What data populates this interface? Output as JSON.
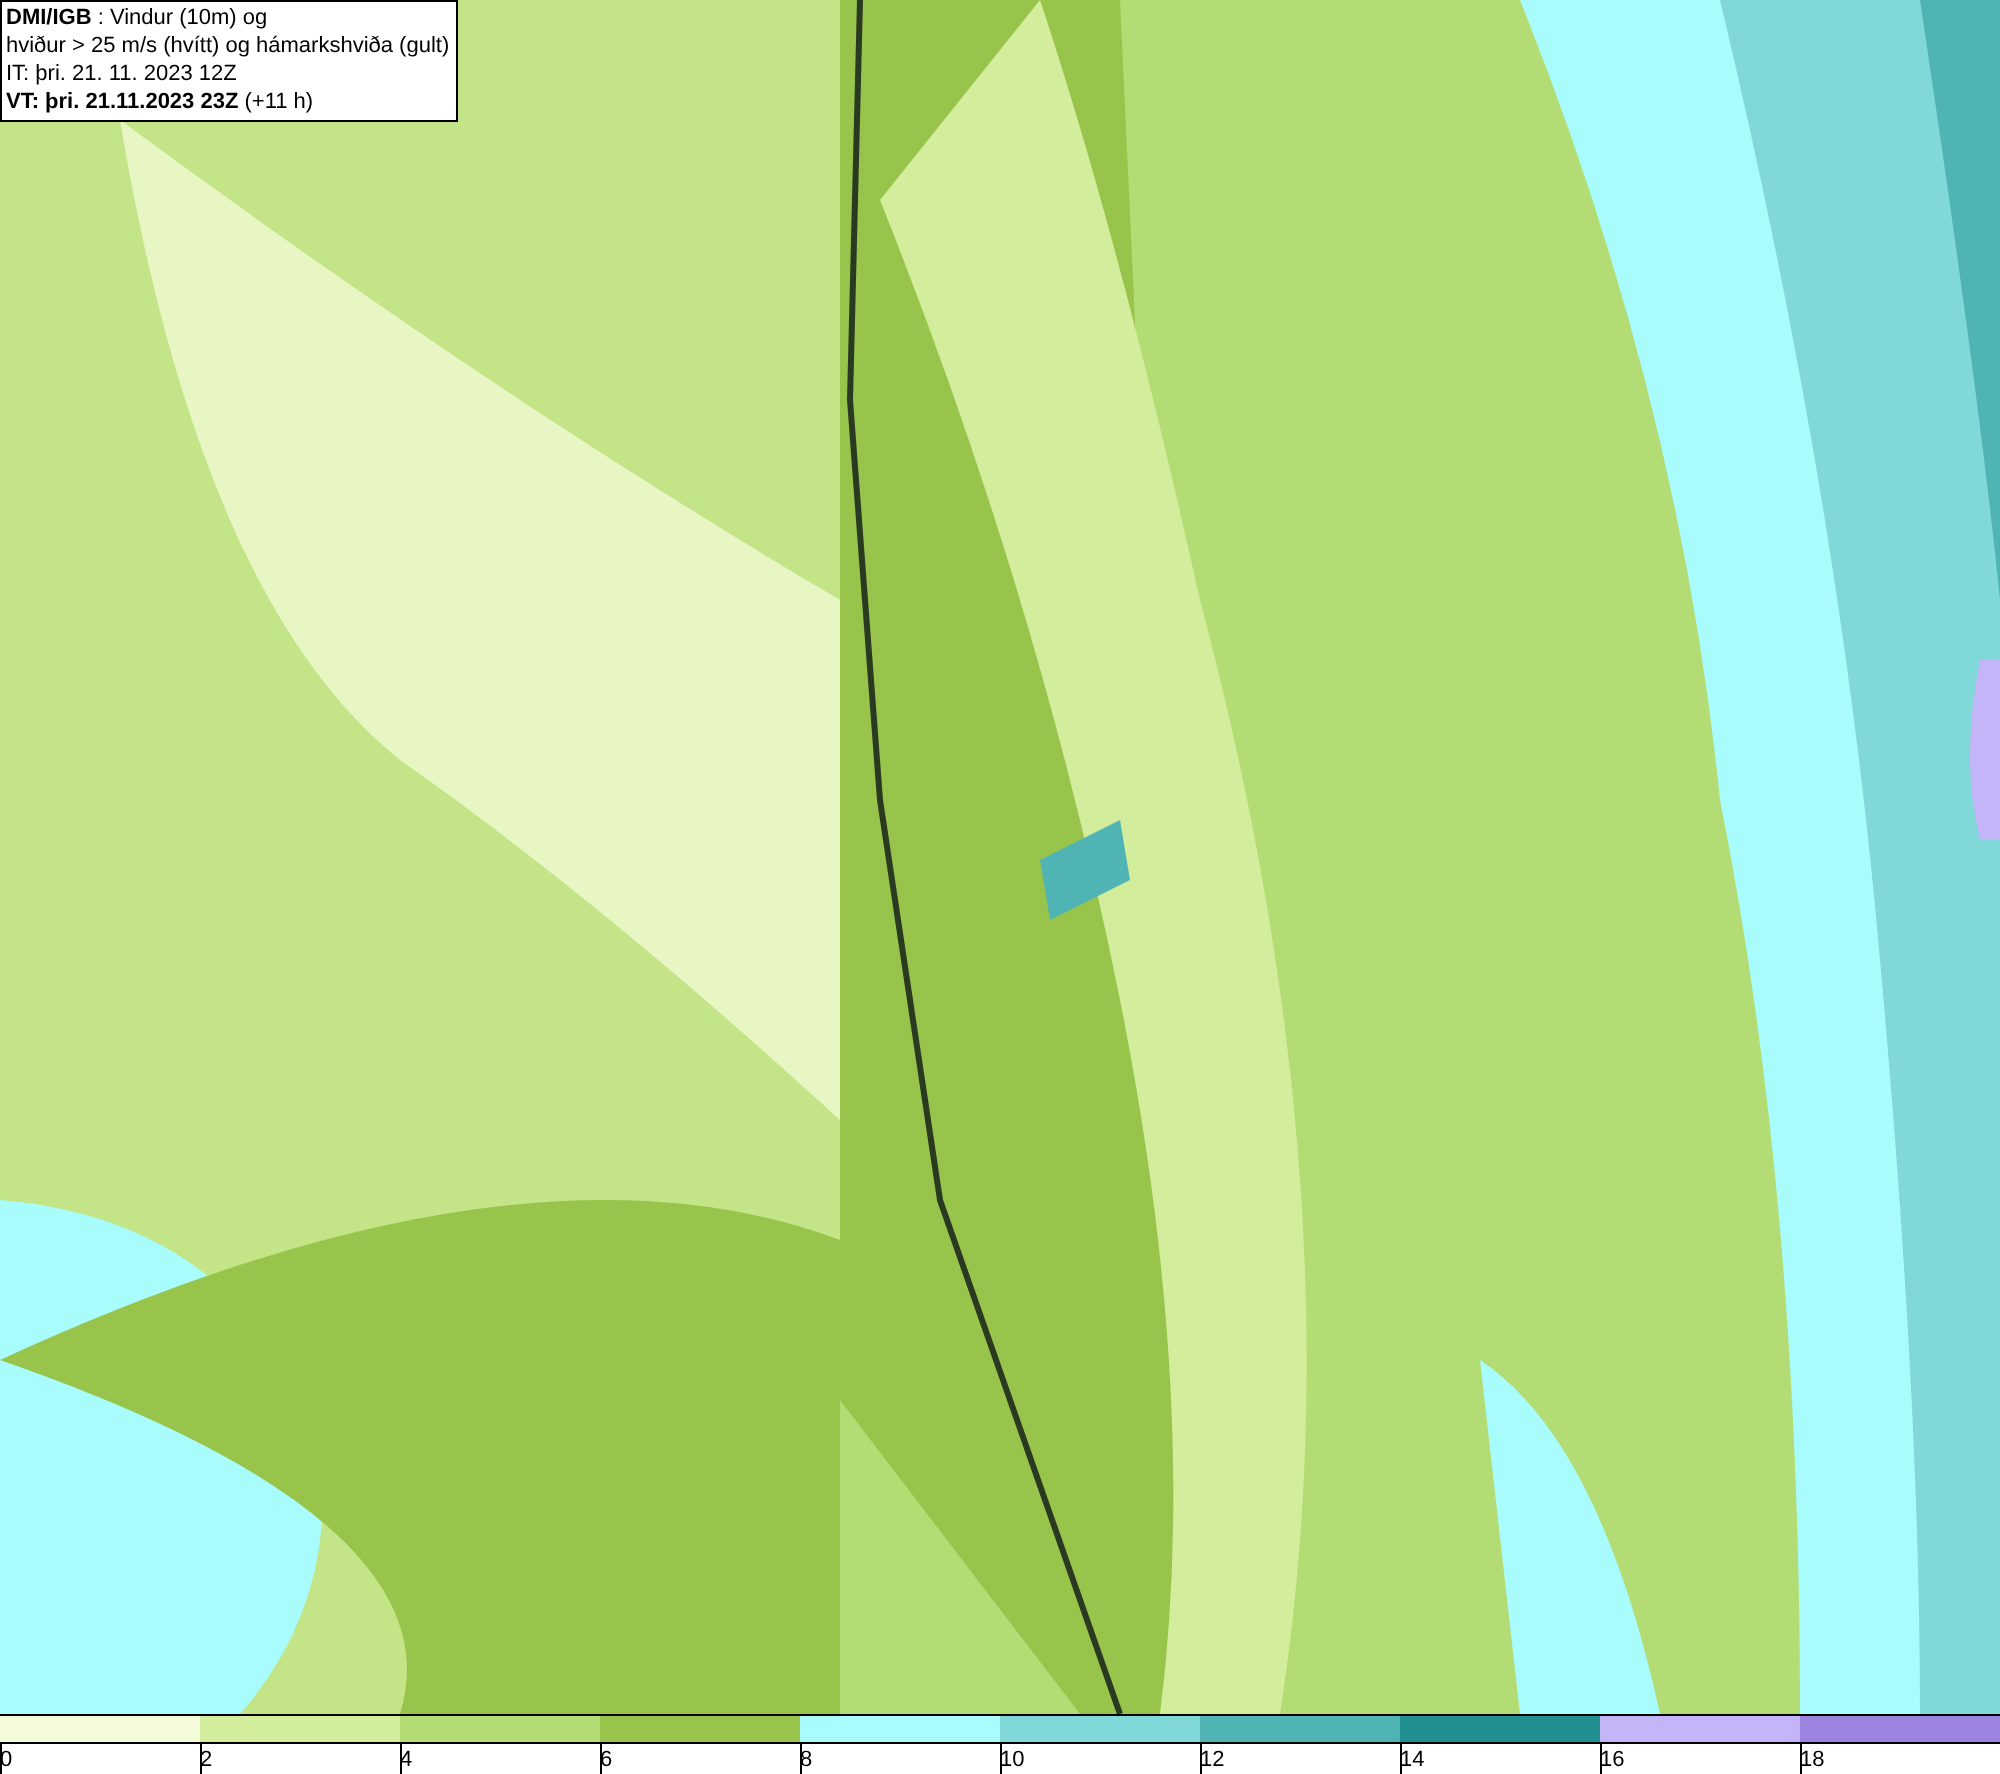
{
  "info_box": {
    "lines": [
      "**DMI/IGB** : Vindur (10m) og",
      "hviður > 25 m/s (hvítt) og hámarkshviða (gult)",
      "IT: þri. 21. 11. 2023 12Z",
      "**VT: þri. 21.11.2023 23Z** (+11 h)"
    ]
  },
  "legend": {
    "bins": [
      {
        "color": "#f4fcdc"
      },
      {
        "color": "#d2ee9c"
      },
      {
        "color": "#b4dc74"
      },
      {
        "color": "#98c44c"
      },
      {
        "color": "#a8fcfc"
      },
      {
        "color": "#80d8d8"
      },
      {
        "color": "#50b4b4"
      },
      {
        "color": "#209090"
      },
      {
        "color": "#c4b4f8"
      },
      {
        "color": "#9c84e0"
      }
    ],
    "ticks": [
      "0",
      "2",
      "4",
      "6",
      "8",
      "10",
      "12",
      "14",
      "16",
      "18"
    ]
  }
}
